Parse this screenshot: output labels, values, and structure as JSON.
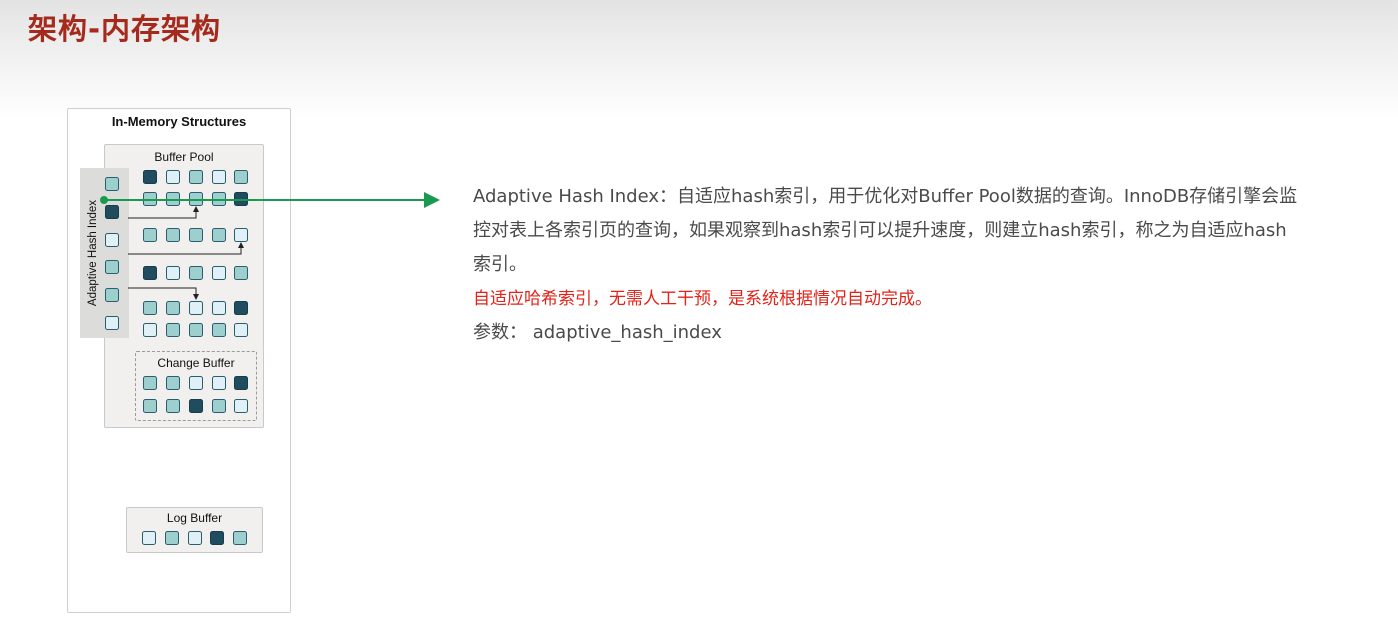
{
  "slide": {
    "title": "架构-内存架构"
  },
  "diagram": {
    "title": "In-Memory Structures",
    "buffer_pool_title": "Buffer Pool",
    "ahi_title": "Adaptive Hash Index",
    "change_buffer_title": "Change Buffer",
    "log_buffer_title": "Log Buffer",
    "arrow_color": "#1a9a4e",
    "ahi_squares": [
      "mid",
      "dark",
      "light",
      "mid",
      "mid",
      "light"
    ],
    "buffer_pool_rows": [
      [
        "dark",
        "light",
        "mid",
        "light",
        "mid"
      ],
      [
        "mid",
        "mid",
        "mid",
        "mid",
        "dark"
      ],
      [
        "mid",
        "mid",
        "mid",
        "mid",
        "light"
      ],
      [
        "dark",
        "light",
        "mid",
        "light",
        "mid"
      ],
      [
        "mid",
        "mid",
        "light",
        "light",
        "dark"
      ],
      [
        "light",
        "mid",
        "mid",
        "mid",
        "light"
      ]
    ],
    "change_buffer_rows": [
      [
        "mid",
        "mid",
        "light",
        "light",
        "dark"
      ],
      [
        "mid",
        "mid",
        "dark",
        "mid",
        "light"
      ]
    ],
    "log_buffer_squares": [
      "light",
      "mid",
      "light",
      "dark",
      "mid"
    ]
  },
  "description": {
    "line1": "Adaptive Hash Index：自适应hash索引，用于优化对Buffer Pool数据的查询。InnoDB存储引擎会监",
    "line2": "控对表上各索引页的查询，如果观察到hash索引可以提升速度，则建立hash索引，称之为自适应hash",
    "line3": "索引。",
    "highlight": "自适应哈希索引，无需人工干预，是系统根据情况自动完成。",
    "param": "参数： adaptive_hash_index"
  }
}
